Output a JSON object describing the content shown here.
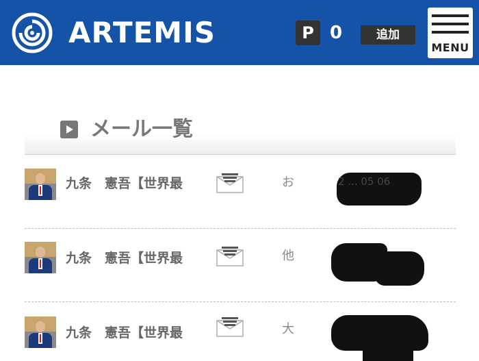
{
  "header": {
    "logo_text": "ARTEMIS",
    "points_badge": "P",
    "points_value": "0",
    "add_label": "追加",
    "menu_label": "MENU",
    "colors": {
      "header_bg": "#1453a8",
      "button_bg": "#333333"
    }
  },
  "section": {
    "title": "メール一覧",
    "icon": "play-square-icon"
  },
  "mails": [
    {
      "sender": "九条　憲吾【世界最",
      "subject": "お",
      "icon": "envelope-icon",
      "date_peek": "2 ... 05 06",
      "date_redacted": true
    },
    {
      "sender": "九条　憲吾【世界最",
      "subject": "他",
      "icon": "envelope-icon",
      "date_peek": "",
      "date_redacted": true
    },
    {
      "sender": "九条　憲吾【世界最",
      "subject": "大",
      "icon": "envelope-icon",
      "date_peek": "",
      "date_redacted": true
    }
  ]
}
